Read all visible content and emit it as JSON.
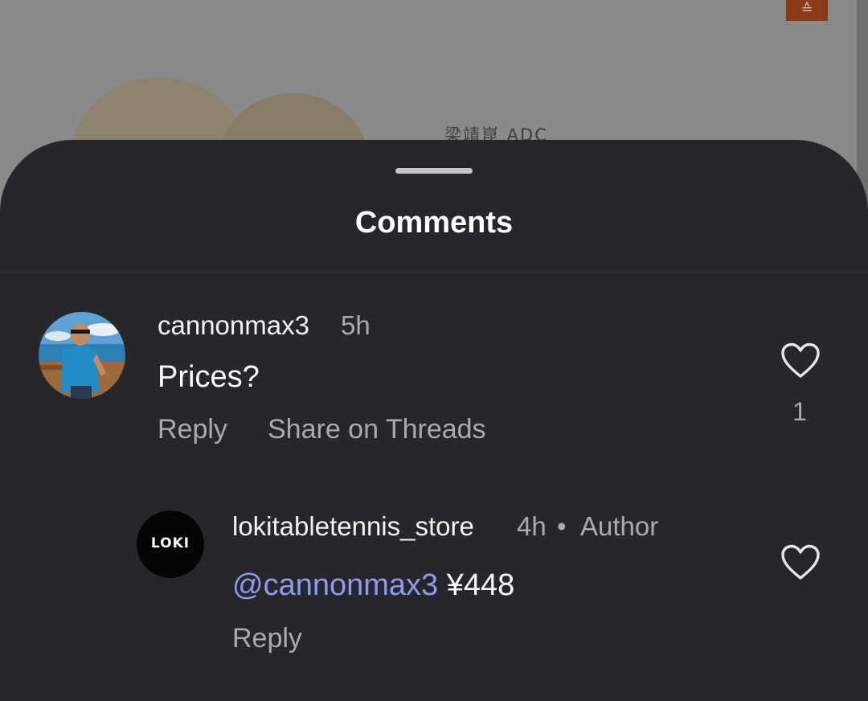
{
  "background": {
    "caption": "梁靖崑 ADC",
    "badge_icon": "collapse-icon",
    "badge_glyph": "≙"
  },
  "sheet": {
    "title": "Comments"
  },
  "comments": [
    {
      "username": "cannonmax3",
      "time": "5h",
      "text": "Prices?",
      "actions": {
        "reply": "Reply",
        "share": "Share on Threads"
      },
      "likes": "1",
      "avatar_icon": "user-photo-avatar"
    },
    {
      "username": "lokitabletennis_store",
      "time": "4h",
      "separator": "•",
      "badge": "Author",
      "mention": "@cannonmax3",
      "text": " ¥448",
      "actions": {
        "reply": "Reply"
      },
      "avatar_text": "LOKI",
      "avatar_icon": "loki-logo-avatar"
    }
  ],
  "colors": {
    "sheet": "#26272b",
    "mention": "#9098f4",
    "muted": "#a9abb0"
  }
}
